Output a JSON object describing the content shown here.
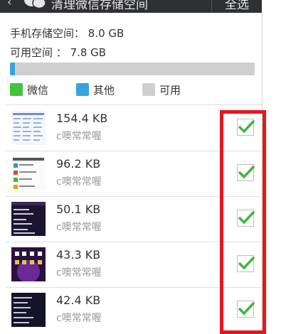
{
  "header": {
    "title": "清理微信存储空间",
    "select_all": "全选"
  },
  "storage": {
    "total_label": "手机存储空间：",
    "total_value": "8.0 GB",
    "free_label": "可用空间 ：",
    "free_value": "7.8 GB",
    "usage": {
      "wechat_fraction": 0.02,
      "other_fraction": 0.0,
      "free_fraction": 0.98
    }
  },
  "legend": [
    {
      "label": "微信",
      "color": "#3fc43b"
    },
    {
      "label": "其他",
      "color": "#35a4e0"
    },
    {
      "label": "可用",
      "color": "#cfcfcf"
    }
  ],
  "files": [
    {
      "size": "154.4 KB",
      "owner": "c噢常常喔",
      "checked": true,
      "thumb": "table-screenshot"
    },
    {
      "size": "96.2 KB",
      "owner": "c噢常常喔",
      "checked": true,
      "thumb": "chat-screenshot"
    },
    {
      "size": "50.1 KB",
      "owner": "c噢常常喔",
      "checked": true,
      "thumb": "dark-menu-screenshot"
    },
    {
      "size": "43.3 KB",
      "owner": "c噢常常喔",
      "checked": true,
      "thumb": "purple-homescreen-screenshot"
    },
    {
      "size": "42.4 KB",
      "owner": "c噢常常喔",
      "checked": true,
      "thumb": "dark-list-screenshot"
    }
  ],
  "colors": {
    "accent_check": "#3fb640",
    "highlight": "#e8141c",
    "topbar": "#2f3033"
  }
}
